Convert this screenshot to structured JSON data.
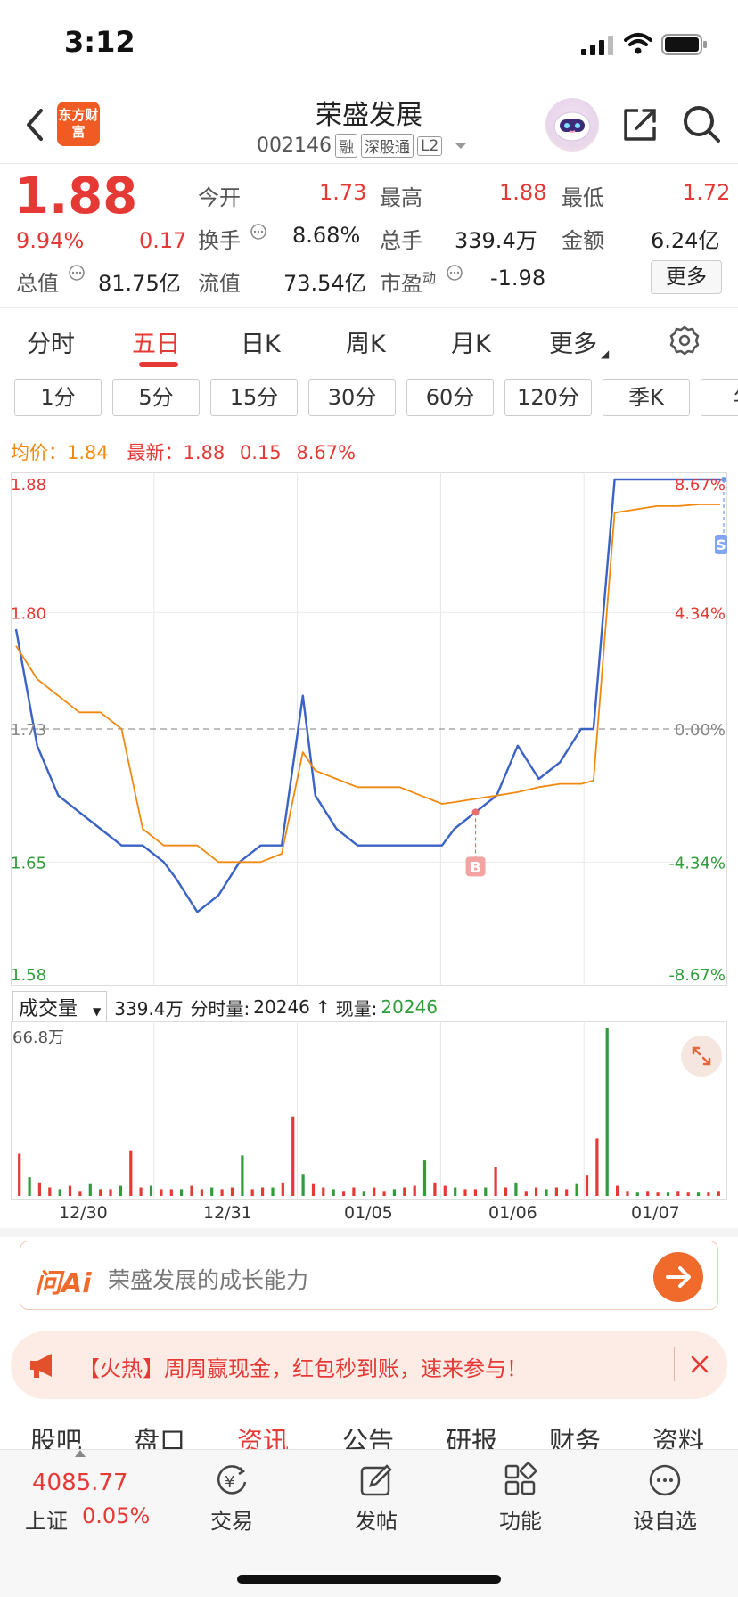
{
  "status_bar": {
    "time": "3:12"
  },
  "header": {
    "logo_text": "东方财富",
    "stock_name": "荣盛发展",
    "stock_code": "002146",
    "tags": [
      "融",
      "深股通",
      "L2"
    ]
  },
  "quote": {
    "price": "1.88",
    "change_pct": "9.94%",
    "change": "0.17",
    "stats": [
      {
        "label": "今开",
        "value": "1.73"
      },
      {
        "label": "最高",
        "value": "1.88"
      },
      {
        "label": "最低",
        "value": "1.72"
      },
      {
        "label": "换手",
        "value": "8.68%"
      },
      {
        "label": "总手",
        "value": "339.4万"
      },
      {
        "label": "金额",
        "value": "6.24亿"
      },
      {
        "label": "总值",
        "value": "81.75亿"
      },
      {
        "label": "流值",
        "value": "73.54亿"
      },
      {
        "label": "市盈",
        "label_sup": "动",
        "value": "-1.98"
      }
    ],
    "more_label": "更多"
  },
  "period_tabs": [
    "分时",
    "五日",
    "日K",
    "周K",
    "月K",
    "更多"
  ],
  "active_period": "五日",
  "minute_buttons": [
    "1分",
    "5分",
    "15分",
    "30分",
    "60分",
    "120分",
    "季K",
    "年"
  ],
  "legend": {
    "avg_label": "均价：",
    "avg_value": "1.84",
    "latest_label": "最新：",
    "latest_value": "1.88",
    "latest_change": "0.15",
    "latest_pct": "8.67%"
  },
  "chart_data": {
    "type": "line",
    "days": [
      "12/30",
      "12/31",
      "01/05",
      "01/06",
      "01/07"
    ],
    "y_ticks_left": [
      "1.88",
      "1.80",
      "1.73",
      "1.65",
      "1.58"
    ],
    "y_ticks_right": [
      "8.67%",
      "4.34%",
      "0.00%",
      "-4.34%",
      "-8.67%"
    ],
    "prev_close": 1.73,
    "ylim": [
      1.58,
      1.88
    ],
    "series": [
      {
        "color": "#3a63c4",
        "values": [
          1.79,
          1.72,
          1.69,
          1.68,
          1.67,
          1.66,
          1.66,
          1.65,
          1.64,
          1.62,
          1.63,
          1.65,
          1.66,
          1.66,
          1.75,
          1.69,
          1.67,
          1.66,
          1.66,
          1.66,
          1.66,
          1.66,
          1.67,
          1.68,
          1.69,
          1.72,
          1.7,
          1.71,
          1.73,
          1.73,
          1.88,
          1.88,
          1.88,
          1.88,
          1.88,
          1.88
        ]
      },
      {
        "color": "#f0890f",
        "values": [
          1.78,
          1.76,
          1.75,
          1.74,
          1.74,
          1.73,
          1.67,
          1.66,
          1.66,
          1.66,
          1.65,
          1.65,
          1.65,
          1.655,
          1.716,
          1.705,
          1.7,
          1.695,
          1.695,
          1.695,
          1.69,
          1.685,
          1.686,
          1.688,
          1.69,
          1.692,
          1.695,
          1.697,
          1.697,
          1.699,
          1.86,
          1.862,
          1.864,
          1.864,
          1.865,
          1.865
        ]
      }
    ],
    "markers": [
      {
        "label": "B"
      },
      {
        "label": "S"
      }
    ]
  },
  "volume": {
    "selector_label": "成交量",
    "total": "339.4万",
    "minute_label": "分时量:",
    "minute_value": "20246",
    "arrow": "↑",
    "current_label": "现量:",
    "current_value": "20246",
    "max_label": "66.8万"
  },
  "volume_data": {
    "type": "bar",
    "heights": [
      0.25,
      0.11,
      0.08,
      0.05,
      0.04,
      0.06,
      0.03,
      0.07,
      0.04,
      0.04,
      0.06,
      0.27,
      0.05,
      0.06,
      0.04,
      0.04,
      0.04,
      0.06,
      0.04,
      0.05,
      0.04,
      0.05,
      0.24,
      0.04,
      0.05,
      0.05,
      0.08,
      0.47,
      0.13,
      0.07,
      0.05,
      0.04,
      0.03,
      0.05,
      0.03,
      0.05,
      0.03,
      0.04,
      0.05,
      0.06,
      0.21,
      0.08,
      0.06,
      0.05,
      0.04,
      0.04,
      0.05,
      0.17,
      0.05,
      0.08,
      0.03,
      0.05,
      0.04,
      0.05,
      0.04,
      0.07,
      0.12,
      0.34,
      0.99,
      0.06,
      0.03,
      0.02,
      0.03,
      0.02,
      0.02,
      0.03,
      0.02,
      0.02,
      0.02,
      0.03
    ]
  },
  "ai_box": {
    "logo": "问Ai",
    "placeholder": "荣盛发展的成长能力"
  },
  "promo": {
    "text": "【火热】周周赢现金，红包秒到账，速来参与！"
  },
  "info_tabs": [
    "股吧",
    "盘口",
    "资讯",
    "公告",
    "研报",
    "财务",
    "资料"
  ],
  "active_info_tab": "资讯",
  "bottom_bar": {
    "index_value": "4085.77",
    "index_name": "上证",
    "index_change": "0.05%",
    "items": [
      "交易",
      "发帖",
      "功能",
      "设自选"
    ]
  }
}
